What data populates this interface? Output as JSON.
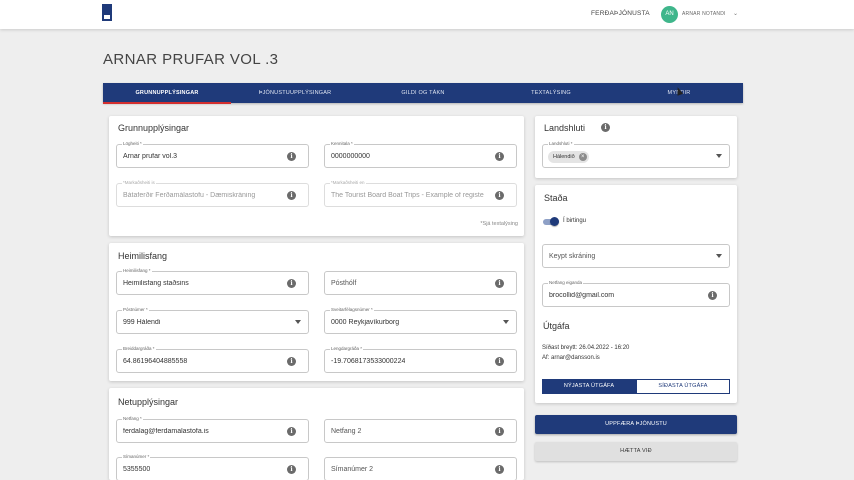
{
  "header": {
    "service_link": "FERÐAÞJÓNUSTA",
    "avatar_initials": "AN",
    "user_name": "ARNAR NOTANDI",
    "chevron": "⌄"
  },
  "page": {
    "title": "ARNAR PRUFAR VOL .3"
  },
  "tabs": [
    {
      "label": "GRUNNUPPLÝSINGAR",
      "active": true
    },
    {
      "label": "ÞJÓNUSTUUPPLÝSINGAR",
      "active": false
    },
    {
      "label": "GILDI OG TÁKN",
      "active": false
    },
    {
      "label": "TEXTALÝSING",
      "active": false
    },
    {
      "label": "MYNDIR",
      "active": false
    }
  ],
  "grunn": {
    "title": "Grunnupplýsingar",
    "logheiti": {
      "label": "Lögheiti *",
      "value": "Arnar prufar vol.3"
    },
    "kennitala": {
      "label": "Kennitala *",
      "value": "0000000000"
    },
    "markadsheiti_is": {
      "label": "*Markaðsheiti is",
      "value": "Bátaferðir Ferðamálastofu - Dæmiskráning"
    },
    "markadsheiti_en": {
      "label": "*Markaðsheiti en",
      "value": "The Tourist Board Boat Trips - Example of registe"
    },
    "hint": "*Sjá textalýsing"
  },
  "heimili": {
    "title": "Heimilisfang",
    "heimilisfang": {
      "label": "Heimilisfang *",
      "value": "Heimilisfang staðsins"
    },
    "posthólf": {
      "placeholder": "Pósthólf"
    },
    "postnumer": {
      "label": "Póstnúmer *",
      "value": "999 Hálendi"
    },
    "sveitarfelag": {
      "label": "Sveitarfélagsnúmer *",
      "value": "0000 Reykjavíkurborg"
    },
    "breidd": {
      "label": "Breiddargráða *",
      "value": "64.86196404885558"
    },
    "lengd": {
      "label": "Lengdargráða *",
      "value": "-19.7068173533000224"
    }
  },
  "net": {
    "title": "Netupplýsingar",
    "netfang": {
      "label": "Netfang *",
      "value": "ferdalag@ferdamalastofa.is"
    },
    "netfang2": {
      "placeholder": "Netfang 2"
    },
    "simanumer": {
      "label": "Símanúmer *",
      "value": "5355500"
    },
    "simanumer2": {
      "placeholder": "Símanúmer 2"
    }
  },
  "landshluti": {
    "title": "Landshluti",
    "field_label": "Landshluti *",
    "chip": "Hálendið",
    "chip_close": "×"
  },
  "stada": {
    "title": "Staða",
    "toggle_label": "Í birtingu",
    "toggle_on": true,
    "keypt": {
      "placeholder": "Keypt skráning"
    },
    "netfang_eiganda": {
      "label": "Netfang eiganda",
      "value": "brocollid@gmail.com"
    }
  },
  "utgafa": {
    "title": "Útgáfa",
    "last_changed": "Síðast breytt: 26.04.2022 - 16:20",
    "author": "Af: arnar@dansson.is",
    "newest_label": "NÝJASTA ÚTGÁFA",
    "previous_label": "SÍÐASTA ÚTGÁFA"
  },
  "actions": {
    "update_label": "UPPFÆRA ÞJÓNUSTU",
    "cancel_label": "HÆTTA VIÐ"
  },
  "icons": {
    "info": "i"
  },
  "colors": {
    "primary": "#1f3a7a",
    "accent": "#d32f2f",
    "avatar": "#3fb68b"
  }
}
